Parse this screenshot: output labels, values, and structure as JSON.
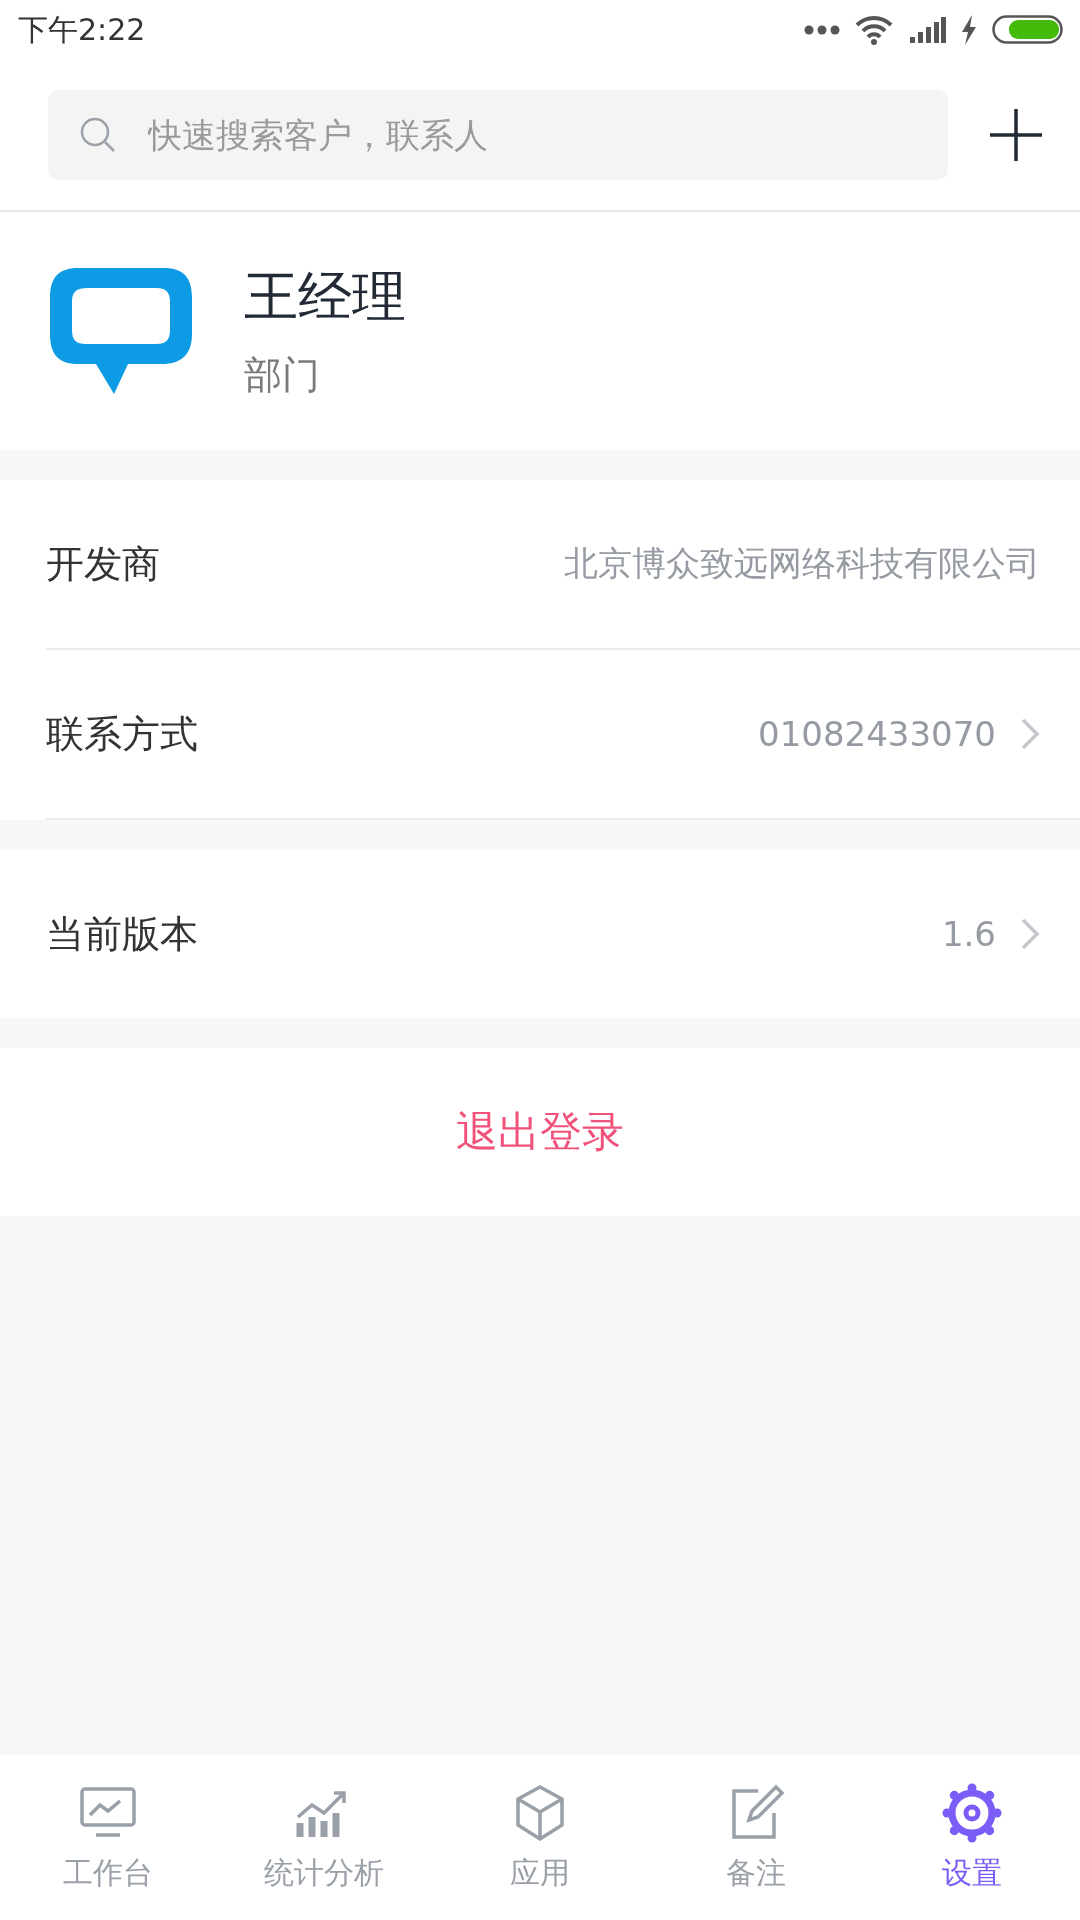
{
  "status_bar": {
    "time": "下午2:22"
  },
  "search": {
    "placeholder": "快速搜索客户，联系人"
  },
  "profile": {
    "name": "王经理",
    "department": "部门"
  },
  "groups": [
    {
      "rows": [
        {
          "label": "开发商",
          "value": "北京博众致远网络科技有限公司",
          "chevron": false
        },
        {
          "label": "联系方式",
          "value": "01082433070",
          "chevron": true
        }
      ]
    },
    {
      "rows": [
        {
          "label": "当前版本",
          "value": "1.6",
          "chevron": true
        }
      ]
    }
  ],
  "logout": "退出登录",
  "tabs": [
    {
      "label": "工作台",
      "kind": "monitor",
      "selected": false
    },
    {
      "label": "统计分析",
      "kind": "chart",
      "selected": false
    },
    {
      "label": "应用",
      "kind": "cube",
      "selected": false
    },
    {
      "label": "备注",
      "kind": "note",
      "selected": false
    },
    {
      "label": "设置",
      "kind": "gear",
      "selected": true
    }
  ]
}
